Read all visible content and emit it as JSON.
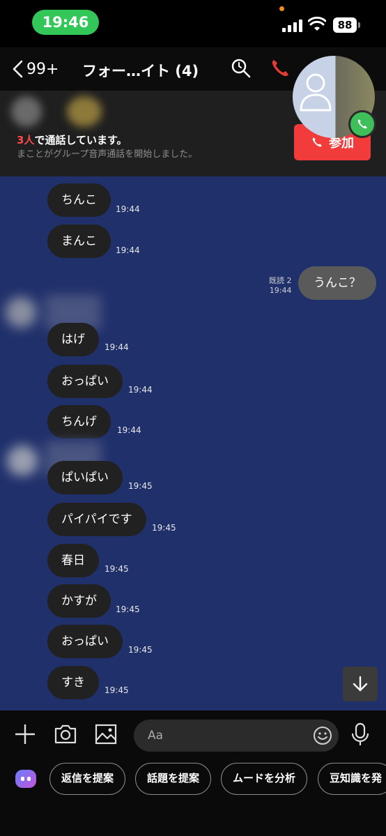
{
  "status": {
    "time": "19:46",
    "battery": "88"
  },
  "header": {
    "back_count": "99+",
    "title": "フォー…イト (4)"
  },
  "call_banner": {
    "count": "3人",
    "count_suffix": "で通話しています。",
    "subtitle": "まことがグループ音声通話を開始しました。",
    "join_label": "参加"
  },
  "messages": [
    {
      "text": "ちんこ",
      "time": "19:44"
    },
    {
      "text": "まんこ",
      "time": "19:44"
    },
    {
      "text": "うんこ？",
      "time": "19:44",
      "read": "既読 2",
      "mine": true
    },
    {
      "text": "はげ",
      "time": "19:44"
    },
    {
      "text": "おっぱい",
      "time": "19:44"
    },
    {
      "text": "ちんげ",
      "time": "19:44"
    },
    {
      "text": "ぱいぱい",
      "time": "19:45"
    },
    {
      "text": "パイパイです",
      "time": "19:45"
    },
    {
      "text": "春日",
      "time": "19:45"
    },
    {
      "text": "かすが",
      "time": "19:45"
    },
    {
      "text": "おっぱい",
      "time": "19:45"
    },
    {
      "text": "すき",
      "time": "19:45"
    }
  ],
  "input": {
    "placeholder": "Aa"
  },
  "suggestions": [
    "返信を提案",
    "話題を提案",
    "ムードを分析",
    "豆知識を発"
  ],
  "colors": {
    "chat_bg": "#20306b",
    "accent_red": "#f23b3b",
    "status_green": "#33c759",
    "call_green": "#3fbf5a"
  }
}
